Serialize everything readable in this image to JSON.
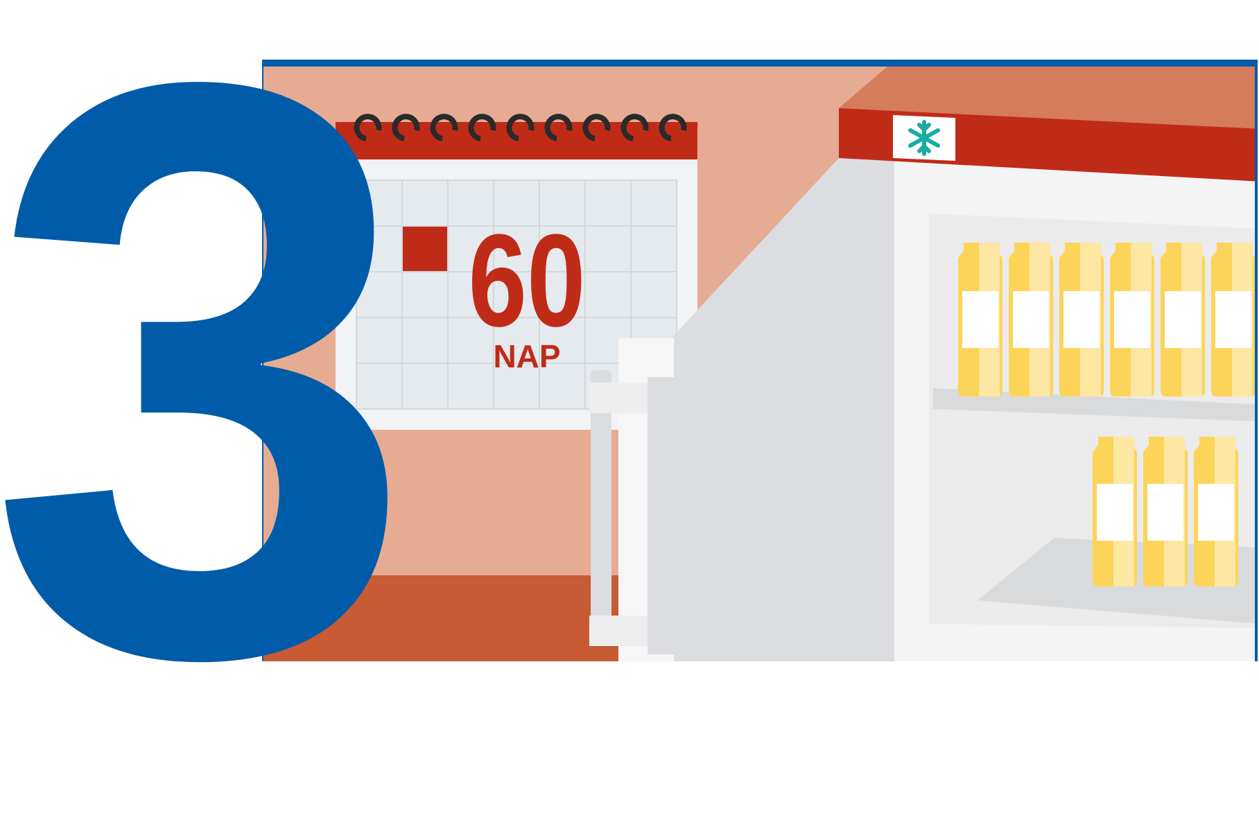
{
  "step_number": "3",
  "calendar": {
    "days_value": "60",
    "days_unit": "NAP"
  },
  "colors": {
    "brand_blue": "#005ba9",
    "wall": "#e6ab93",
    "floor": "#c85a34",
    "calendar_red": "#c02b18",
    "fridge_top": "#d47c5c",
    "fridge_panel": "#ededed",
    "bottle_yellow": "#fcd45a",
    "snowflake_teal": "#1aaba3"
  },
  "icons": [
    "snowflake-icon",
    "calendar-icon",
    "bottle-icon"
  ]
}
